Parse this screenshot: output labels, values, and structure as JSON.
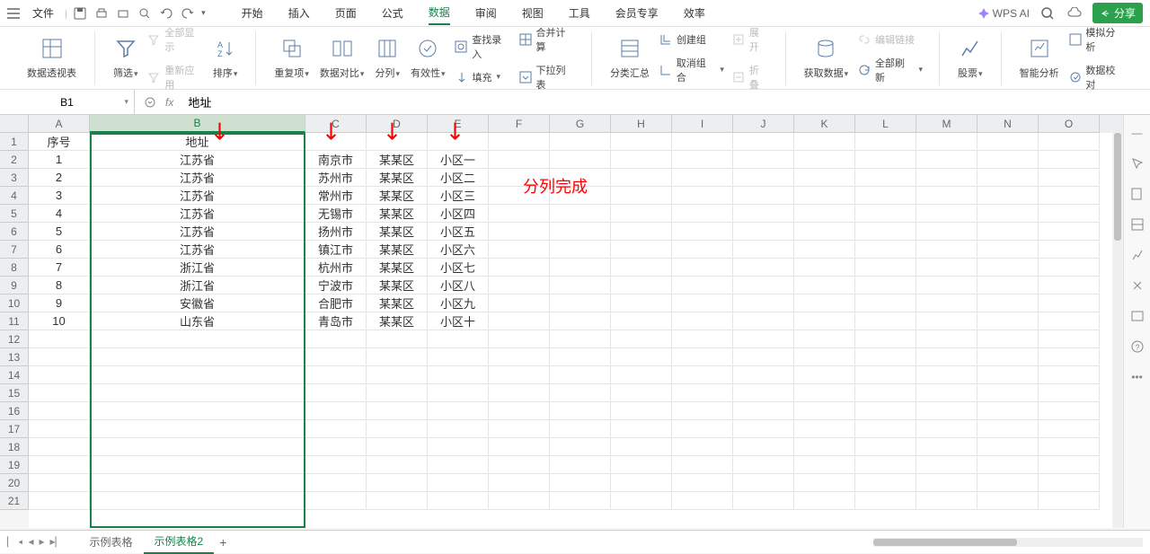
{
  "menu": {
    "file": "文件",
    "tabs": [
      "开始",
      "插入",
      "页面",
      "公式",
      "数据",
      "审阅",
      "视图",
      "工具",
      "会员专享",
      "效率"
    ],
    "active_tab": "数据",
    "wps_ai": "WPS AI",
    "share": "分享"
  },
  "ribbon": {
    "pivot": "数据透视表",
    "filter": "筛选",
    "show_all": "全部显示",
    "reapply": "重新应用",
    "sort": "排序",
    "duplicates": "重复项",
    "compare": "数据对比",
    "split": "分列",
    "validation": "有效性",
    "find_input": "查找录入",
    "fill": "填充",
    "consolidate": "合并计算",
    "dropdown": "下拉列表",
    "subtotal": "分类汇总",
    "group": "创建组",
    "ungroup": "取消组合",
    "expand": "展开",
    "collapse": "折叠",
    "get_data": "获取数据",
    "edit_links": "编辑链接",
    "refresh_all": "全部刷新",
    "stocks": "股票",
    "smart_analysis": "智能分析",
    "simulation": "模拟分析",
    "data_check": "数据校对"
  },
  "formula_bar": {
    "name_box": "B1",
    "fx": "fx",
    "formula": "地址"
  },
  "columns": [
    "A",
    "B",
    "C",
    "D",
    "E",
    "F",
    "G",
    "H",
    "I",
    "J",
    "K",
    "L",
    "M",
    "N",
    "O"
  ],
  "col_widths": {
    "A": 68,
    "B": 240,
    "default": 68
  },
  "row_count": 21,
  "grid_data": {
    "headers": {
      "A1": "序号",
      "B1": "地址"
    },
    "rows": [
      {
        "n": "1",
        "prov": "江苏省",
        "city": "南京市",
        "dist": "某某区",
        "zone": "小区一"
      },
      {
        "n": "2",
        "prov": "江苏省",
        "city": "苏州市",
        "dist": "某某区",
        "zone": "小区二"
      },
      {
        "n": "3",
        "prov": "江苏省",
        "city": "常州市",
        "dist": "某某区",
        "zone": "小区三"
      },
      {
        "n": "4",
        "prov": "江苏省",
        "city": "无锡市",
        "dist": "某某区",
        "zone": "小区四"
      },
      {
        "n": "5",
        "prov": "江苏省",
        "city": "扬州市",
        "dist": "某某区",
        "zone": "小区五"
      },
      {
        "n": "6",
        "prov": "江苏省",
        "city": "镇江市",
        "dist": "某某区",
        "zone": "小区六"
      },
      {
        "n": "7",
        "prov": "浙江省",
        "city": "杭州市",
        "dist": "某某区",
        "zone": "小区七"
      },
      {
        "n": "8",
        "prov": "浙江省",
        "city": "宁波市",
        "dist": "某某区",
        "zone": "小区八"
      },
      {
        "n": "9",
        "prov": "安徽省",
        "city": "合肥市",
        "dist": "某某区",
        "zone": "小区九"
      },
      {
        "n": "10",
        "prov": "山东省",
        "city": "青岛市",
        "dist": "某某区",
        "zone": "小区十"
      }
    ]
  },
  "annotation_text": "分列完成",
  "sheets": {
    "tabs": [
      "示例表格",
      "示例表格2"
    ],
    "active": "示例表格2"
  }
}
